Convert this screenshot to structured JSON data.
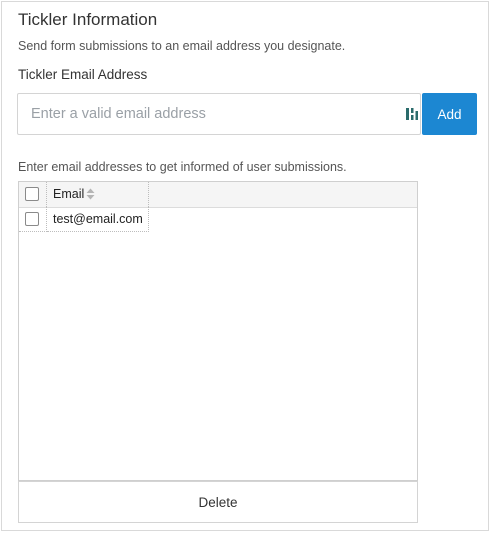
{
  "panel": {
    "title": "Tickler Information",
    "subtitle": "Send form submissions to an email address you designate.",
    "field_label": "Tickler Email Address",
    "email_input": {
      "value": "",
      "placeholder": "Enter a valid email address",
      "extension_icon": "password-manager-icon"
    },
    "add_label": "Add",
    "help_text": "Enter email addresses to get informed of user submissions.",
    "grid": {
      "columns": [
        {
          "label": "Email",
          "sort_icon": "sort-arrows-icon"
        }
      ],
      "rows": [
        {
          "email": "test@email.com",
          "checked": false
        }
      ]
    },
    "delete_label": "Delete"
  },
  "colors": {
    "accent": "#1c87d2",
    "border": "#d4d4d4",
    "header_bg": "#f5f5f5"
  }
}
